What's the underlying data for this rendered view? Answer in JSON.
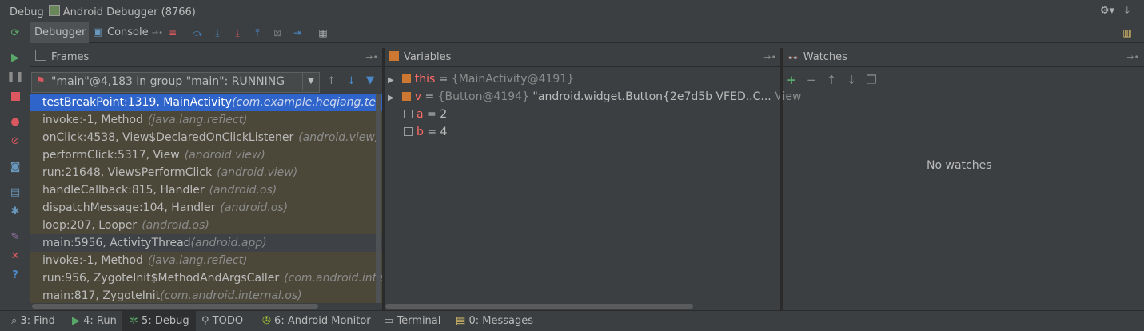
{
  "window": {
    "title": "Debug",
    "session": "Android Debugger (8766)"
  },
  "toolbar": {
    "tabs": [
      {
        "label": "Debugger"
      },
      {
        "label": "Console"
      }
    ]
  },
  "frames": {
    "title": "Frames",
    "thread": "\"main\"@4,183 in group \"main\": RUNNING",
    "items": [
      {
        "method": "testBreakPoint:1319, MainActivity",
        "pkg": "(com.example.heqiang.testso"
      },
      {
        "method": "invoke:-1, Method",
        "pkg": "(java.lang.reflect)"
      },
      {
        "method": "onClick:4538, View$DeclaredOnClickListener",
        "pkg": "(android.view)"
      },
      {
        "method": "performClick:5317, View",
        "pkg": "(android.view)"
      },
      {
        "method": "run:21648, View$PerformClick",
        "pkg": "(android.view)"
      },
      {
        "method": "handleCallback:815, Handler",
        "pkg": "(android.os)"
      },
      {
        "method": "dispatchMessage:104, Handler",
        "pkg": "(android.os)"
      },
      {
        "method": "loop:207, Looper",
        "pkg": "(android.os)"
      },
      {
        "method": "main:5956, ActivityThread",
        "pkg": "(android.app)"
      },
      {
        "method": "invoke:-1, Method",
        "pkg": "(java.lang.reflect)"
      },
      {
        "method": "run:956, ZygoteInit$MethodAndArgsCaller",
        "pkg": "(com.android.intern"
      },
      {
        "method": "main:817, ZygoteInit",
        "pkg": "(com.android.internal.os)"
      }
    ]
  },
  "variables": {
    "title": "Variables",
    "items": [
      {
        "name": "this",
        "eq": " = ",
        "type": "{MainActivity@4191}",
        "value": ""
      },
      {
        "name": "v",
        "eq": " = ",
        "type": "{Button@4194}",
        "value": " \"android.widget.Button{2e7d5b VFED..C...",
        "link": " View"
      },
      {
        "name": "a",
        "eq": " = ",
        "value": "2"
      },
      {
        "name": "b",
        "eq": " = ",
        "value": "4"
      }
    ]
  },
  "watches": {
    "title": "Watches",
    "empty": "No watches"
  },
  "bottom_tabs": [
    {
      "num": "3",
      "label": ": Find"
    },
    {
      "num": "4",
      "label": ": Run"
    },
    {
      "num": "5",
      "label": ": Debug"
    },
    {
      "num": "",
      "label": "TODO"
    },
    {
      "num": "6",
      "label": ": Android Monitor"
    },
    {
      "num": "",
      "label": "Terminal"
    },
    {
      "num": "0",
      "label": ": Messages"
    }
  ],
  "colors": {
    "selection": "#2f65ca",
    "library_frame": "#4b4739",
    "background": "#3c3f41",
    "var_name": "#cc7832",
    "field_name": "#ff6b68"
  }
}
